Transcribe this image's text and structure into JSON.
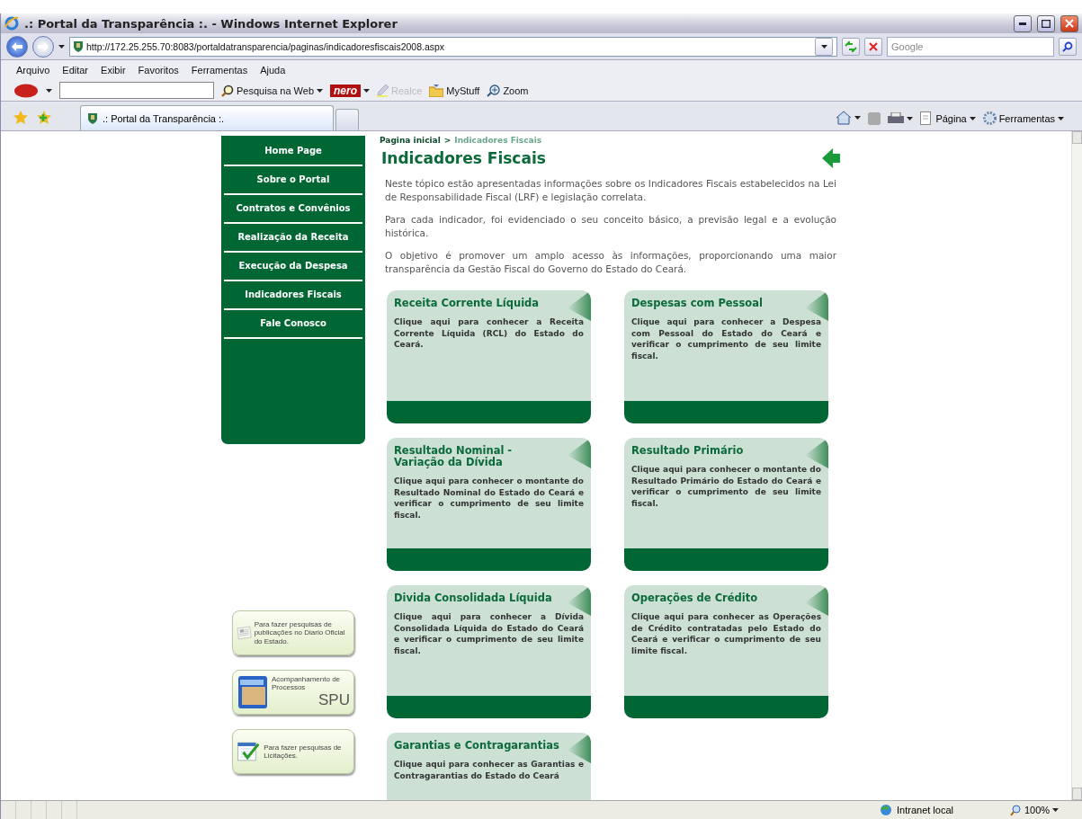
{
  "window": {
    "title": ".: Portal da Transparência :. - Windows Internet Explorer"
  },
  "address": {
    "url": "http://172.25.255.70:8083/portaldatransparencia/paginas/indicadoresfiscais2008.aspx"
  },
  "search": {
    "placeholder": "Google"
  },
  "menu": [
    "Arquivo",
    "Editar",
    "Exibir",
    "Favoritos",
    "Ferramentas",
    "Ajuda"
  ],
  "toolbar": [
    {
      "kind": "search",
      "label": "Pesquisa na Web",
      "disabled": false
    },
    {
      "kind": "nero",
      "label": "nero",
      "disabled": false
    },
    {
      "kind": "highlight",
      "label": "Realce",
      "disabled": true
    },
    {
      "kind": "mystuff",
      "label": "MyStuff",
      "disabled": false
    },
    {
      "kind": "zoom",
      "label": "Zoom",
      "disabled": false
    }
  ],
  "tabs": [
    {
      "label": ".: Portal da Transparência :.",
      "selected": true
    }
  ],
  "command_bar": [
    "Página",
    "Ferramentas"
  ],
  "sidebar": {
    "items": [
      "Home Page",
      "Sobre o Portal",
      "Contratos e Convênios",
      "Realização da Receita",
      "Execução da Despesa",
      "Indicadores Fiscais",
      "Fale Conosco"
    ]
  },
  "breadcrumb": {
    "home": "Pagina inicial",
    "separator": ">",
    "current": "Indicadores Fiscais"
  },
  "heading": "Indicadores Fiscais",
  "paragraphs": [
    "Neste tópico estão apresentadas informações sobre os Indicadores Fiscais estabelecidos na Lei de Responsabilidade Fiscal (LRF) e legislação correlata.",
    "Para cada indicador, foi evidenciado o seu conceito básico, a previsão legal e a evolução histórica.",
    "O objetivo é promover um amplo acesso às informações, proporcionando uma maior transparência da Gestão Fiscal do Governo do Estado do Ceará."
  ],
  "cards": [
    {
      "title": "Receita Corrente Líquida",
      "text": "Clique aqui para conhecer a Receita Corrente Líquida (RCL) do Estado do Ceará."
    },
    {
      "title": "Despesas com Pessoal",
      "text": "Clique aqui para conhecer a Despesa com Pessoal do Estado do Ceará e verificar o cumprimento de seu limite fiscal."
    },
    {
      "title": "Resultado Nominal - Variação da Dívida",
      "text": "Clique aqui para conhecer o montante do Resultado Nominal do Estado do Ceará e verificar o cumprimento de seu limite fiscal."
    },
    {
      "title": "Resultado Primário",
      "text": "Clique aqui para conhecer o montante do Resultado Primário do Estado do Ceará e verificar o cumprimento de seu limite fiscal."
    },
    {
      "title": "Divida Consolidada Líquida",
      "text": "Clique aqui para conhecer a Dívida Consolidada Líquida do Estado do Ceará e verificar o cumprimento de seu limite fiscal."
    },
    {
      "title": "Operações de Crédito",
      "text": "Clique aqui para conhecer as Operações de Crédito contratadas pelo Estado do Ceará e verificar o cumprimento de seu limite fiscal."
    },
    {
      "title": "Garantias e Contragarantias",
      "text": "Clique aqui para conhecer as Garantias e Contragarantias do Estado do Ceará"
    }
  ],
  "side_links": [
    {
      "kind": "newspaper",
      "text": "Para fazer pesquisas de publicações no Diario Oficial do Estado."
    },
    {
      "kind": "folder",
      "text": "Acompanhamento de Processos",
      "badge": "SPU"
    },
    {
      "kind": "check",
      "text": "Para fazer pesquisas de Licitações."
    }
  ],
  "status_bar": {
    "zone": "Intranet local",
    "zoom": "100%"
  }
}
